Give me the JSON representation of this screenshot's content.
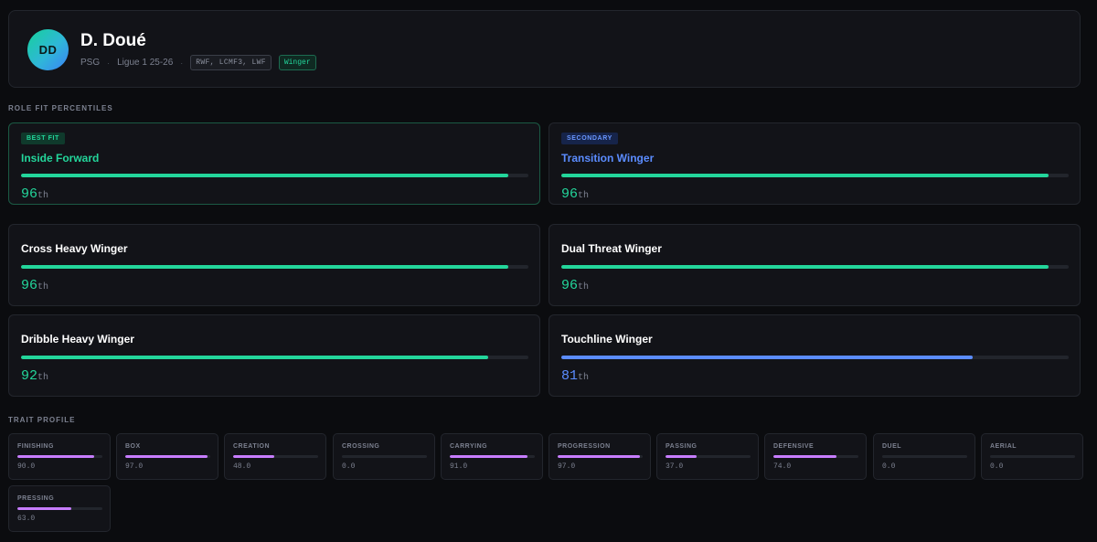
{
  "player": {
    "initials": "DD",
    "name": "D. Doué",
    "club": "PSG",
    "separator": "·",
    "competition": "Ligue 1 25-26",
    "positions": "RWF, LCMF3, LWF",
    "role": "Winger"
  },
  "sections": {
    "role_fit": "ROLE FIT PERCENTILES",
    "traits": "TRAIT PROFILE"
  },
  "colors": {
    "green": "#23d69b",
    "blue": "#5b8cff",
    "purple": "#c77dff"
  },
  "roles": [
    {
      "badge": "BEST FIT",
      "badge_type": "best",
      "name": "Inside Forward",
      "percentile": 96,
      "pct_text": "96",
      "suffix": "th",
      "color": "#23d69b",
      "name_style": "green"
    },
    {
      "badge": "SECONDARY",
      "badge_type": "secondary",
      "name": "Transition Winger",
      "percentile": 96,
      "pct_text": "96",
      "suffix": "th",
      "color": "#23d69b",
      "name_style": "blue"
    },
    {
      "badge": "",
      "badge_type": "",
      "name": "Cross Heavy Winger",
      "percentile": 96,
      "pct_text": "96",
      "suffix": "th",
      "color": "#23d69b",
      "name_style": ""
    },
    {
      "badge": "",
      "badge_type": "",
      "name": "Dual Threat Winger",
      "percentile": 96,
      "pct_text": "96",
      "suffix": "th",
      "color": "#23d69b",
      "name_style": ""
    },
    {
      "badge": "",
      "badge_type": "",
      "name": "Dribble Heavy Winger",
      "percentile": 92,
      "pct_text": "92",
      "suffix": "th",
      "color": "#23d69b",
      "name_style": ""
    },
    {
      "badge": "",
      "badge_type": "",
      "name": "Touchline Winger",
      "percentile": 81,
      "pct_text": "81",
      "suffix": "th",
      "color": "#5b8cff",
      "name_style": ""
    }
  ],
  "traits": [
    {
      "label": "FINISHING",
      "value": 90.0,
      "value_text": "90.0"
    },
    {
      "label": "BOX",
      "value": 97.0,
      "value_text": "97.0"
    },
    {
      "label": "CREATION",
      "value": 48.0,
      "value_text": "48.0"
    },
    {
      "label": "CROSSING",
      "value": 0.0,
      "value_text": "0.0"
    },
    {
      "label": "CARRYING",
      "value": 91.0,
      "value_text": "91.0"
    },
    {
      "label": "PROGRESSION",
      "value": 97.0,
      "value_text": "97.0"
    },
    {
      "label": "PASSING",
      "value": 37.0,
      "value_text": "37.0"
    },
    {
      "label": "DEFENSIVE",
      "value": 74.0,
      "value_text": "74.0"
    },
    {
      "label": "DUEL",
      "value": 0.0,
      "value_text": "0.0"
    },
    {
      "label": "AERIAL",
      "value": 0.0,
      "value_text": "0.0"
    },
    {
      "label": "PRESSING",
      "value": 63.0,
      "value_text": "63.0"
    }
  ]
}
